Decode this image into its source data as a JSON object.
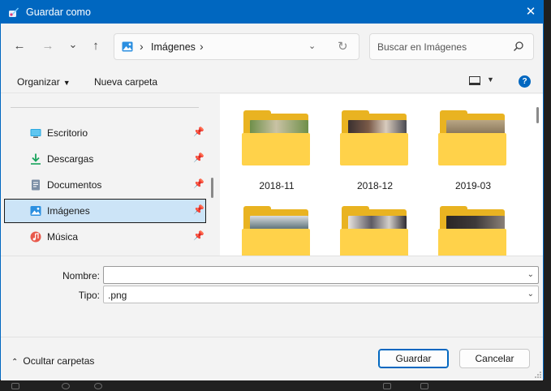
{
  "window": {
    "title": "Guardar como",
    "close_glyph": "✕"
  },
  "nav": {
    "back_glyph": "←",
    "forward_glyph": "→",
    "recent_glyph": "⌄",
    "up_glyph": "↑",
    "breadcrumb_sep": "›",
    "breadcrumb": [
      "Imágenes"
    ],
    "dropdown_glyph": "⌄",
    "refresh_glyph": "↻",
    "search_placeholder": "Buscar en Imágenes"
  },
  "toolbar": {
    "organize_label": "Organizar",
    "organize_caret": "▼",
    "new_folder_label": "Nueva carpeta",
    "view_caret": "▼",
    "help_glyph": "?"
  },
  "sidebar": {
    "pin_glyph": "📌",
    "items": [
      {
        "label": "Escritorio",
        "icon": "desktop-icon",
        "selected": false
      },
      {
        "label": "Descargas",
        "icon": "download-icon",
        "selected": false
      },
      {
        "label": "Documentos",
        "icon": "document-icon",
        "selected": false
      },
      {
        "label": "Imágenes",
        "icon": "pictures-icon",
        "selected": true
      },
      {
        "label": "Música",
        "icon": "music-icon",
        "selected": false
      }
    ]
  },
  "folders": [
    {
      "name": "2018-11",
      "photo_color": "#6f8f4a"
    },
    {
      "name": "2018-12",
      "photo_color": "#7a5a48"
    },
    {
      "name": "2019-03",
      "photo_color": "#8c7a5e"
    },
    {
      "name": "",
      "photo_color": "#6d7f86"
    },
    {
      "name": "",
      "photo_color": "#5d5a63"
    },
    {
      "name": "",
      "photo_color": "#3e3a3a"
    }
  ],
  "form": {
    "filename_label": "Nombre:",
    "filename_value": "",
    "type_label": "Tipo:",
    "type_value": ".png",
    "chevron_glyph": "⌄"
  },
  "footer": {
    "toggle_glyph": "⌃",
    "hide_folders_label": "Ocultar carpetas",
    "save_label": "Guardar",
    "cancel_label": "Cancelar"
  },
  "colors": {
    "accent": "#0067c0",
    "folder_back": "#e9b321",
    "folder_front": "#ffd24a",
    "selection": "#cce4f7"
  }
}
